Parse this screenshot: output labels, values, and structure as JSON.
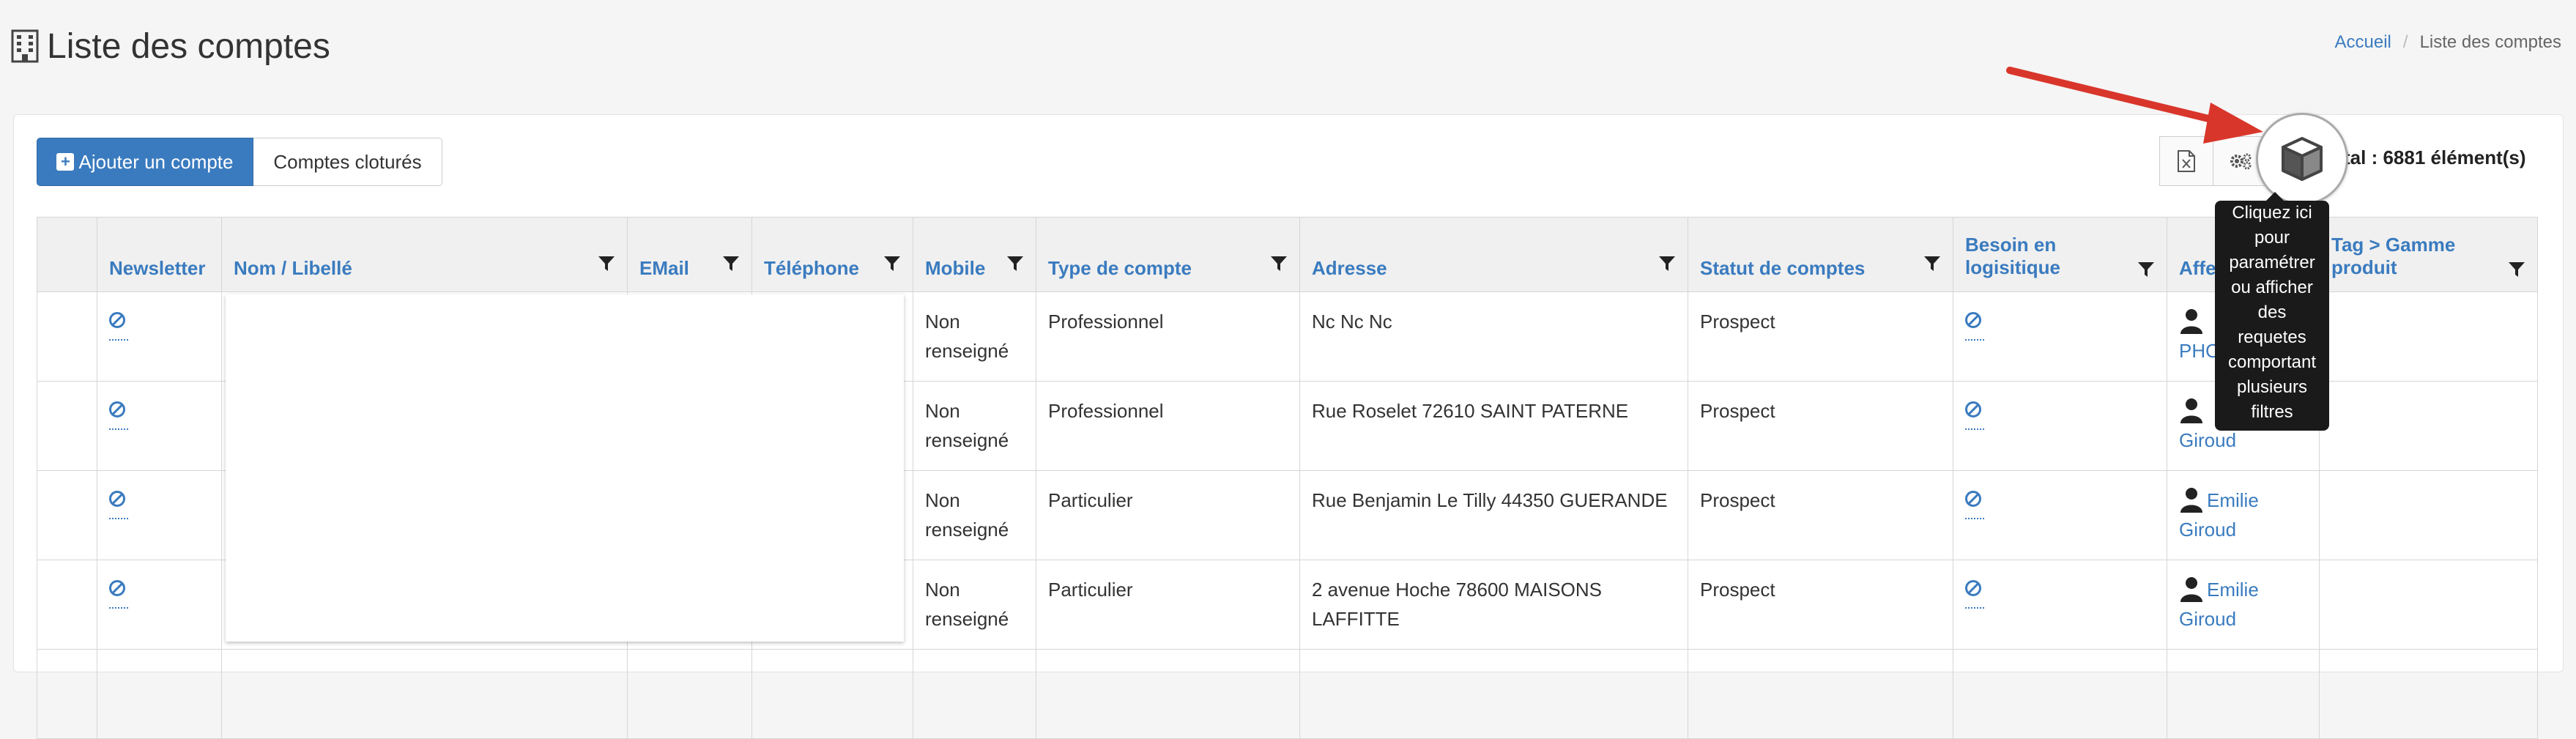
{
  "header": {
    "title": "Liste des comptes",
    "breadcrumb": {
      "home": "Accueil",
      "separator": "/",
      "current": "Liste des comptes"
    }
  },
  "toolbar": {
    "add_label": "Ajouter un compte",
    "closed_label": "Comptes cloturés",
    "total_label": "tal : 6881 élément(s)"
  },
  "tooltip": {
    "text": "Cliquez ici\npour\nparamétrer\nou afficher\ndes\nrequetes\ncomportant\nplusieurs\nfiltres"
  },
  "table": {
    "headers": {
      "newsletter": "Newsletter",
      "nom": "Nom / Libellé",
      "email": "EMail",
      "telephone": "Téléphone",
      "mobile": "Mobile",
      "type": "Type de compte",
      "adresse": "Adresse",
      "statut": "Statut de comptes",
      "besoin": "Besoin en logisitique",
      "affectation": "Affec",
      "tag": "Tag > Gamme produit"
    },
    "rows": [
      {
        "mobile1": "Non",
        "mobile2": "renseigné",
        "type": "Professionnel",
        "adresse": "Nc Nc Nc",
        "statut": "Prospect",
        "user1": "",
        "user2": "PHO"
      },
      {
        "mobile1": "Non",
        "mobile2": "renseigné",
        "type": "Professionnel",
        "adresse": "Rue Roselet 72610 SAINT PATERNE",
        "statut": "Prospect",
        "user1": "",
        "user2": "Giroud"
      },
      {
        "mobile1": "Non",
        "mobile2": "renseigné",
        "type": "Particulier",
        "adresse": "Rue Benjamin Le Tilly 44350 GUERANDE",
        "statut": "Prospect",
        "user1": "Emilie",
        "user2": "Giroud"
      },
      {
        "mobile1": "Non",
        "mobile2": "renseigné",
        "type": "Particulier",
        "adresse": "2 avenue Hoche 78600 MAISONS LAFFITTE",
        "statut": "Prospect",
        "user1": "Emilie",
        "user2": "Giroud"
      }
    ]
  },
  "icons": {
    "title": "building-icon",
    "export": "excel-export-icon",
    "settings": "gears-icon",
    "query": "cube-icon",
    "filter": "filter-icon",
    "newsletter": "ban-icon",
    "user": "user-icon"
  },
  "colors": {
    "accent": "#3a7bbf",
    "arrow": "#d9362b",
    "tooltip_bg": "#1a1a1a"
  }
}
